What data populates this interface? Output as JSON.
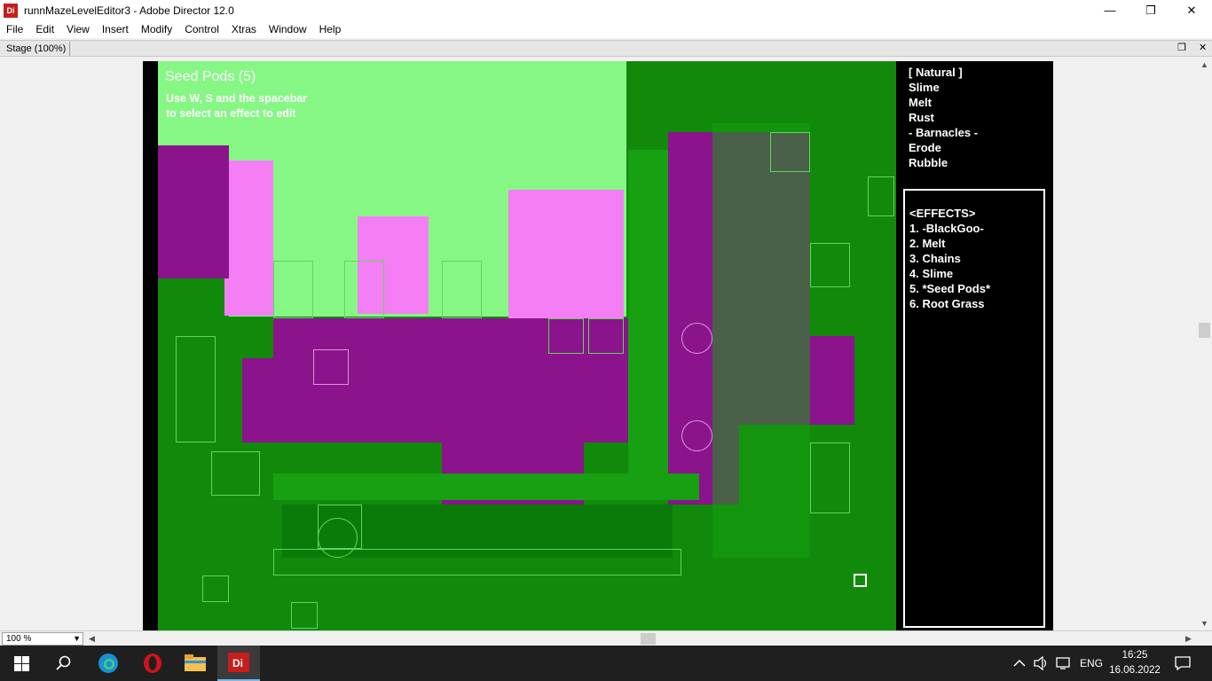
{
  "window": {
    "app_icon_text": "Di",
    "title": "runnMazeLevelEditor3 - Adobe Director 12.0",
    "controls": {
      "minimize": "—",
      "restore": "❐",
      "close": "✕"
    }
  },
  "menubar": {
    "items": [
      {
        "label": "File"
      },
      {
        "label": "Edit"
      },
      {
        "label": "View"
      },
      {
        "label": "Insert"
      },
      {
        "label": "Modify"
      },
      {
        "label": "Control"
      },
      {
        "label": "Xtras"
      },
      {
        "label": "Window"
      },
      {
        "label": "Help"
      }
    ]
  },
  "stage_tab": {
    "label": "Stage (100%)",
    "restore_icon": "❐",
    "close_icon": "✕"
  },
  "game": {
    "title": "Seed Pods (5)",
    "hint": "Use W, S and the spacebar to select an effect to edit"
  },
  "right_panel": {
    "categories": [
      "[ Natural ]",
      "Slime",
      "Melt",
      "Rust",
      "- Barnacles -",
      "Erode",
      "Rubble"
    ],
    "effects_header": "<EFFECTS>",
    "effects": [
      "1. -BlackGoo-",
      "2. Melt",
      "3. Chains",
      "4. Slime",
      "5. *Seed Pods*",
      "6. Root Grass"
    ]
  },
  "bottom": {
    "zoom": "100 %"
  },
  "taskbar": {
    "tray_lang": "ENG",
    "time": "16:25",
    "date": "16.06.2022"
  },
  "colors": {
    "game_bg": "#118a0b",
    "light_green": "#86f785",
    "pink": "#f47ef4",
    "purple": "#8b138c",
    "panel_bg": "#000000"
  }
}
